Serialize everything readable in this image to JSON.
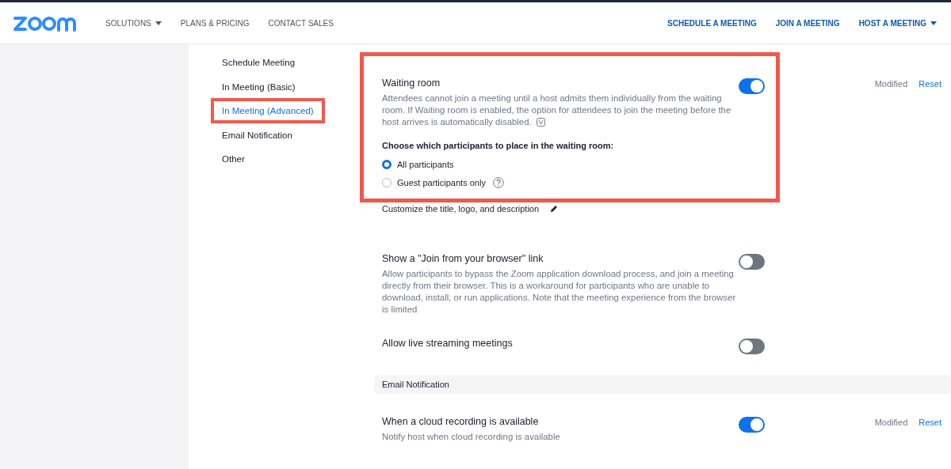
{
  "header": {
    "nav": [
      {
        "label": "SOLUTIONS",
        "dropdown": true
      },
      {
        "label": "PLANS & PRICING",
        "dropdown": false
      },
      {
        "label": "CONTACT SALES",
        "dropdown": false
      }
    ],
    "actions": [
      {
        "label": "SCHEDULE A MEETING",
        "dropdown": false
      },
      {
        "label": "JOIN A MEETING",
        "dropdown": false
      },
      {
        "label": "HOST A MEETING",
        "dropdown": true
      }
    ]
  },
  "sidebar": {
    "items": [
      {
        "label": "Schedule Meeting",
        "selected": false,
        "highlighted": false
      },
      {
        "label": "In Meeting (Basic)",
        "selected": false,
        "highlighted": false
      },
      {
        "label": "In Meeting (Advanced)",
        "selected": true,
        "highlighted": true
      },
      {
        "label": "Email Notification",
        "selected": false,
        "highlighted": false
      },
      {
        "label": "Other",
        "selected": false,
        "highlighted": false
      }
    ]
  },
  "settings": [
    {
      "kind": "toggle",
      "title": "Waiting room",
      "description": "Attendees cannot join a meeting until a host admits them individually from the waiting room. If Waiting room is enabled, the option for attendees to join the meeting before the host arrives is automatically disabled.",
      "info_icon": true,
      "on": true,
      "highlighted": true,
      "status": "Modified",
      "reset": "Reset",
      "options_title": "Choose which participants to place in the waiting room:",
      "options": [
        {
          "label": "All participants",
          "selected": true,
          "help": false
        },
        {
          "label": "Guest participants only",
          "selected": false,
          "help": true
        }
      ]
    },
    {
      "kind": "link",
      "title": "Customize the title, logo, and description"
    },
    {
      "kind": "toggle",
      "title": "Show a \"Join from your browser\" link",
      "description": "Allow participants to bypass the Zoom application download process, and join a meeting directly from their browser. This is a workaround for participants who are unable to download, install, or run applications. Note that the meeting experience from the browser is limited",
      "on": false,
      "highlighted": false
    },
    {
      "kind": "toggle",
      "title": "Allow live streaming meetings",
      "on": false,
      "highlighted": false
    },
    {
      "kind": "section",
      "title": "Email Notification"
    },
    {
      "kind": "toggle",
      "title": "When a cloud recording is available",
      "description": "Notify host when cloud recording is available",
      "on": true,
      "highlighted": false,
      "status": "Modified",
      "reset": "Reset"
    }
  ]
}
